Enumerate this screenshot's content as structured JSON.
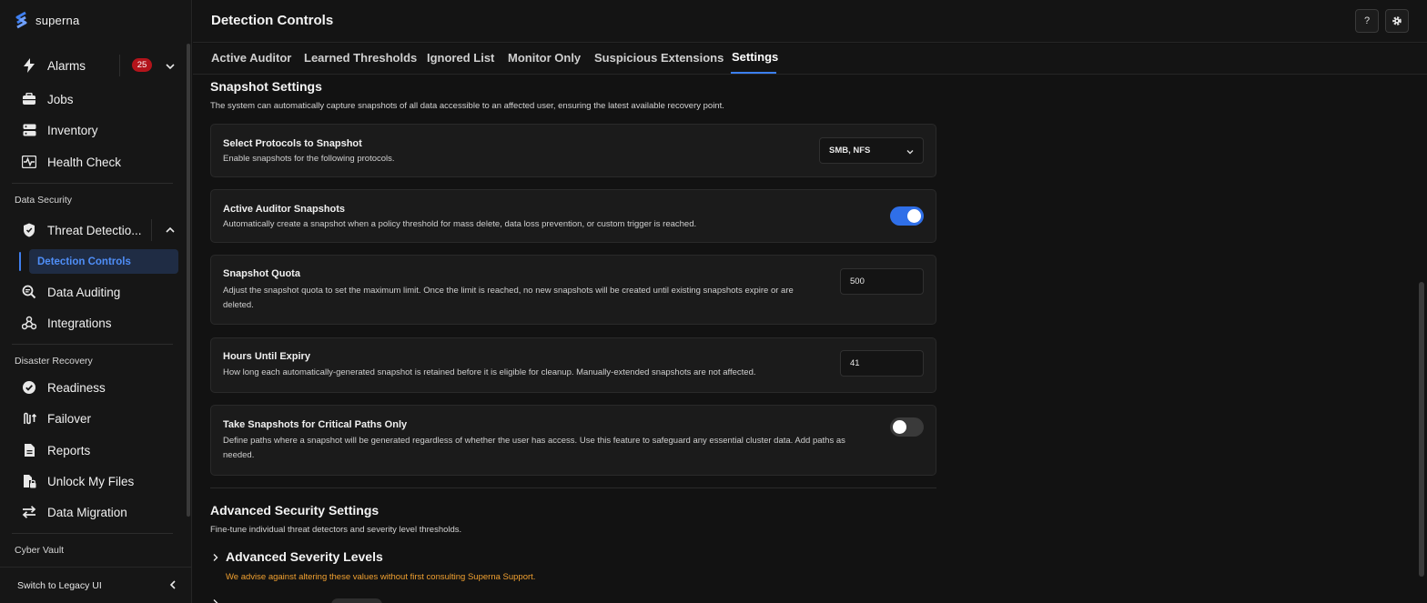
{
  "brand": {
    "name": "superna"
  },
  "sidebar": {
    "alarms": {
      "label": "Alarms",
      "count": "25"
    },
    "items_top": [
      {
        "label": "Jobs"
      },
      {
        "label": "Inventory"
      },
      {
        "label": "Health Check"
      }
    ],
    "sections": {
      "data_security": "Data Security",
      "disaster_recovery": "Disaster Recovery",
      "cyber_vault": "Cyber Vault"
    },
    "threat_detection": {
      "label": "Threat Detectio..."
    },
    "detection_controls": {
      "label": "Detection Controls"
    },
    "data_auditing": {
      "label": "Data Auditing"
    },
    "integrations": {
      "label": "Integrations"
    },
    "dr_items": [
      {
        "label": "Readiness"
      },
      {
        "label": "Failover"
      },
      {
        "label": "Reports"
      },
      {
        "label": "Unlock My Files"
      },
      {
        "label": "Data Migration"
      }
    ],
    "legacy": "Switch to Legacy UI"
  },
  "header": {
    "title": "Detection Controls",
    "help_label": "?"
  },
  "tabs": [
    {
      "label": "Active Auditor"
    },
    {
      "label": "Learned Thresholds"
    },
    {
      "label": "Ignored List"
    },
    {
      "label": "Monitor Only"
    },
    {
      "label": "Suspicious Extensions"
    },
    {
      "label": "Settings",
      "active": true
    }
  ],
  "snapshot": {
    "title": "Snapshot Settings",
    "description": "The system can automatically capture snapshots of all data accessible to an affected user, ensuring the latest available recovery point.",
    "protocols": {
      "title": "Select Protocols to Snapshot",
      "description": "Enable snapshots for the following protocols.",
      "value": "SMB, NFS"
    },
    "auditor": {
      "title": "Active Auditor Snapshots",
      "description": "Automatically create a snapshot when a policy threshold for mass delete, data loss prevention, or custom trigger is reached.",
      "enabled": true
    },
    "quota": {
      "title": "Snapshot Quota",
      "description_1": "Adjust the snapshot quota to set the maximum limit. Once the limit is reached, no new snapshots will be created until existing snapshots expire or are",
      "description_2": "deleted.",
      "value": "500"
    },
    "expiry": {
      "title": "Hours Until Expiry",
      "description": "How long each automatically-generated snapshot is retained before it is eligible for cleanup. Manually-extended snapshots are not affected.",
      "value": "41"
    },
    "critical": {
      "title": "Take Snapshots for Critical Paths Only",
      "description_1": "Define paths where a snapshot will be generated regardless of whether the user has access. Use this feature to safeguard any essential cluster data. Add paths as",
      "description_2": "needed.",
      "enabled": false
    }
  },
  "advanced": {
    "title": "Advanced Security Settings",
    "description": "Fine-tune individual threat detectors and severity level thresholds.",
    "severity": {
      "title": "Advanced Severity Levels",
      "warning": "We advise against altering these values without first consulting Superna Support."
    }
  },
  "colors": {
    "accent": "#2f6fe8",
    "badge": "#b3141b",
    "warning": "#f0a030"
  }
}
